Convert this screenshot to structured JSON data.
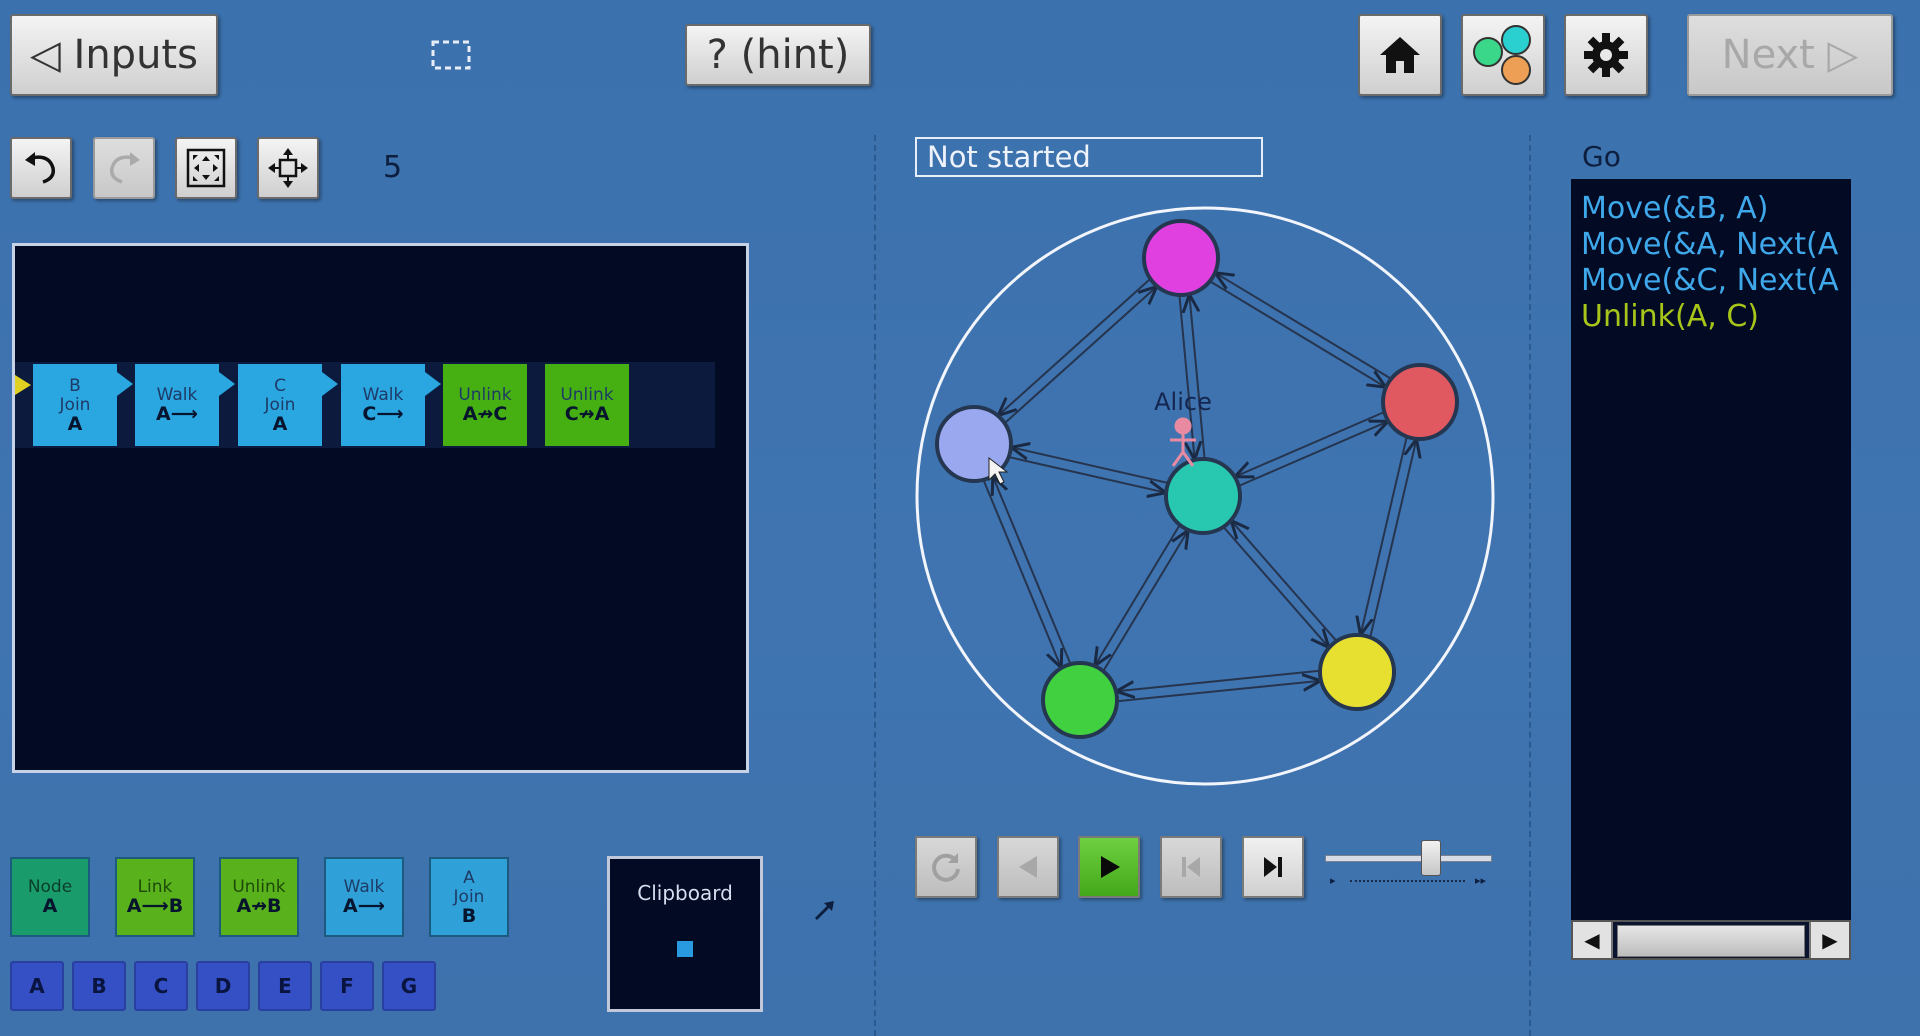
{
  "toolbar": {
    "inputs_label": "◁ Inputs",
    "hint_label": "? (hint)",
    "next_label": "Next ▷",
    "count": "5"
  },
  "program": {
    "tiles": [
      {
        "top": "B",
        "mid": "Join",
        "bottom": "A",
        "color": "blue"
      },
      {
        "top": "Walk",
        "mid": "",
        "bottom": "A⟶",
        "color": "blue"
      },
      {
        "top": "C",
        "mid": "Join",
        "bottom": "A",
        "color": "blue"
      },
      {
        "top": "Walk",
        "mid": "",
        "bottom": "C⟶",
        "color": "blue"
      },
      {
        "top": "Unlink",
        "mid": "",
        "bottom": "A↛C",
        "color": "green"
      },
      {
        "top": "Unlink",
        "mid": "",
        "bottom": "C↛A",
        "color": "green"
      }
    ]
  },
  "palette": {
    "tiles": [
      {
        "top": "Node",
        "bottom": "A",
        "mid": "",
        "color": "teal"
      },
      {
        "top": "Link",
        "bottom": "A⟶B",
        "mid": "",
        "color": "ltgreen"
      },
      {
        "top": "Unlink",
        "bottom": "A↛B",
        "mid": "",
        "color": "ltgreen"
      },
      {
        "top": "Walk",
        "bottom": "A⟶",
        "mid": "",
        "color": "sky"
      },
      {
        "top": "A",
        "bottom": "B",
        "mid": "Join",
        "color": "sky"
      }
    ],
    "letters": [
      "A",
      "B",
      "C",
      "D",
      "E",
      "F",
      "G"
    ]
  },
  "clipboard": {
    "label": "Clipboard"
  },
  "status": {
    "text": "Not started"
  },
  "graph": {
    "agent_label": "Alice",
    "node_colors": [
      "#e040e0",
      "#e05860",
      "#e8e030",
      "#40d040",
      "#9aa8f0",
      "#28c8b0"
    ]
  },
  "code": {
    "title": "Go",
    "lines": [
      {
        "text": "Move(&B, A)",
        "active": false
      },
      {
        "text": "Move(&A, Next(A",
        "active": false
      },
      {
        "text": "Move(&C, Next(A",
        "active": false
      },
      {
        "text": "Unlink(A, C)",
        "active": true
      }
    ]
  },
  "playback": {
    "speed_fraction": 0.65
  },
  "colors": {
    "background": "#3d72ad",
    "dark_panel": "#030a24"
  }
}
